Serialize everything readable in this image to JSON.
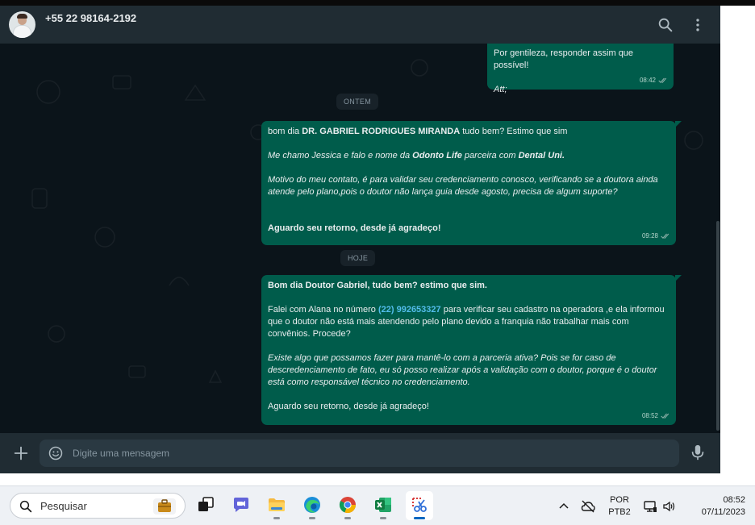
{
  "header": {
    "contact_name": "+55 22 98164-2192",
    "search_icon": "search-icon",
    "menu_icon": "vertical-dots-icon"
  },
  "colors": {
    "app_background": "#0b141a",
    "header_background": "#202c33",
    "outgoing_bubble": "#005c4b",
    "link": "#53bdeb",
    "taskbar": "#eef1f5"
  },
  "messages": {
    "m0": {
      "line1": "Por gentileza, responder assim que possível!",
      "line2": "Att;",
      "time": "08:42"
    },
    "divider_yesterday": "ONTEM",
    "m1": {
      "p1_pre": "bom dia ",
      "p1_name": "DR. GABRIEL RODRIGUES MIRANDA",
      "p1_post": " tudo bem? Estimo que sim",
      "p2_pre": "Me chamo Jessica e falo e nome da ",
      "p2_company": "Odonto Life",
      "p2_mid": " parceira com ",
      "p2_partner": "Dental Uni.",
      "p3": "Motivo do meu contato, é para validar seu credenciamento conosco, verificando se a doutora ainda atende pelo plano,pois o doutor não lança guia desde agosto, precisa de algum suporte?",
      "p4": "Aguardo seu retorno, desde já agradeço!",
      "time": "09:28"
    },
    "divider_today": "HOJE",
    "m2": {
      "p1": "Bom dia Doutor Gabriel, tudo bem? estimo que sim.",
      "p2_pre": "Falei com Alana no número  ",
      "p2_phone": "(22) 992653327",
      "p2_post": " para verificar seu cadastro na operadora ,e ela informou que o doutor não está mais atendendo pelo plano devido a franquia não trabalhar mais com convênios. Procede?",
      "p3": "Existe algo que possamos fazer para mantê-lo com a parceria ativa? Pois se for caso de descredenciamento de fato, eu só posso realizar após a validação com o doutor, porque é o doutor está como responsável técnico no credenciamento.",
      "p4": "Aguardo seu retorno, desde já agradeço!",
      "time": "08:52"
    }
  },
  "footer": {
    "placeholder": "Digite uma mensagem",
    "attach_icon": "plus-icon",
    "emoji_icon": "emoji-icon",
    "mic_icon": "microphone-icon"
  },
  "taskbar": {
    "search_placeholder": "Pesquisar",
    "apps": [
      "task-view",
      "teams-chat",
      "file-explorer",
      "edge",
      "chrome",
      "excel",
      "snipping-tool"
    ],
    "active_app": "snipping-tool",
    "language_line1": "POR",
    "language_line2": "PTB2",
    "time": "08:52",
    "date": "07/11/2023"
  }
}
